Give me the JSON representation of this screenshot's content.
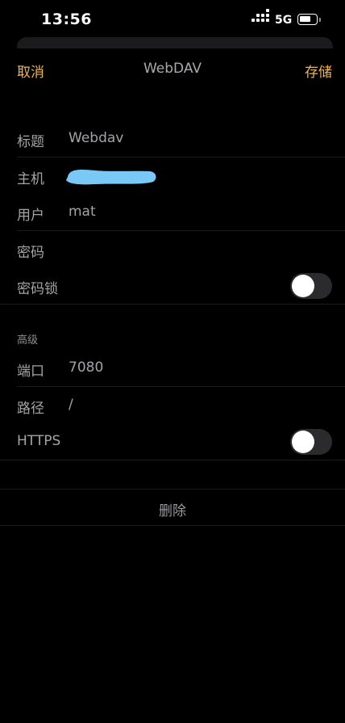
{
  "status_bar": {
    "time": "13:56",
    "network": "5G",
    "icons": [
      "signal-icon",
      "battery-icon"
    ]
  },
  "nav": {
    "cancel_label": "取消",
    "title": "WebDAV",
    "save_label": "存储"
  },
  "form": {
    "rows": [
      {
        "label": "标题",
        "value": "Webdav"
      },
      {
        "label": "主机",
        "value": ""
      },
      {
        "label": "用户",
        "value": "mat"
      },
      {
        "label": "密码",
        "value": ""
      },
      {
        "label": "密码锁",
        "toggle": false
      }
    ],
    "advanced_header": "高级",
    "advanced_rows": [
      {
        "label": "端口",
        "value": "7080"
      },
      {
        "label": "路径",
        "value": "/"
      },
      {
        "label": "HTTPS",
        "toggle": false
      }
    ],
    "delete_label": "删除"
  },
  "colors": {
    "accent": "#f0b35a",
    "redaction": "#79c8f5",
    "toggle_off": "#2b2b2e"
  }
}
